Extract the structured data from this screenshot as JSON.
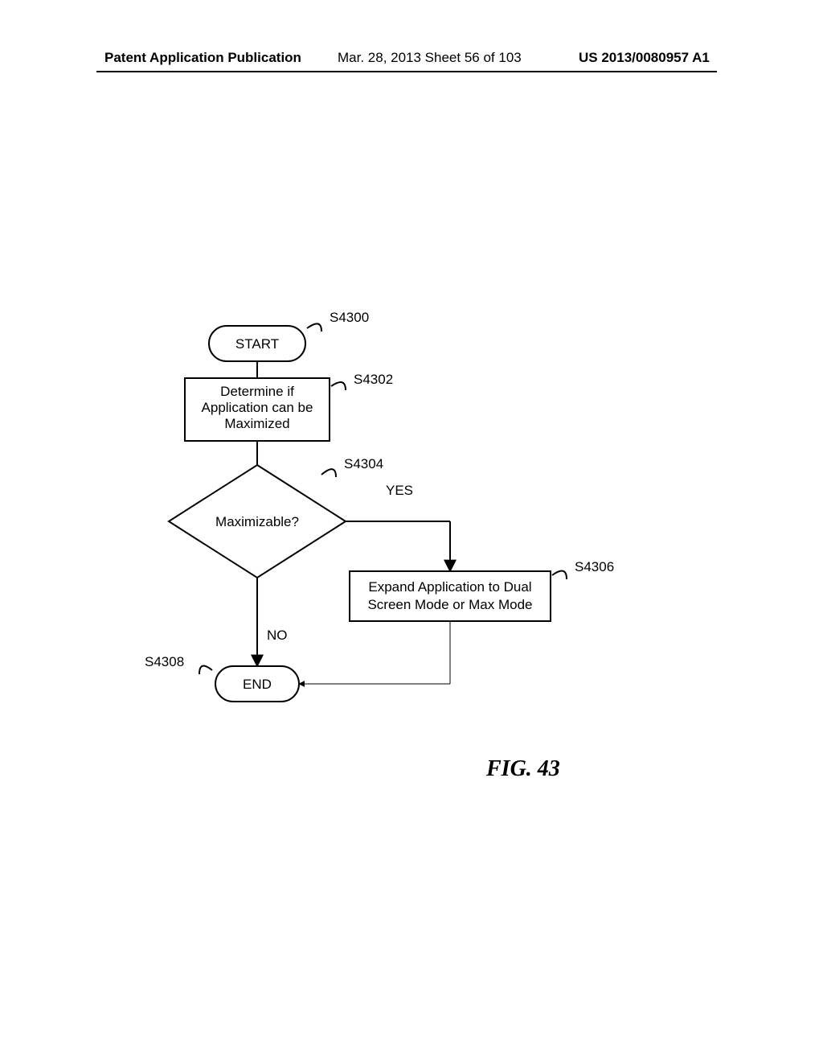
{
  "header": {
    "left": "Patent Application Publication",
    "mid": "Mar. 28, 2013  Sheet 56 of 103",
    "right": "US 2013/0080957 A1"
  },
  "flowchart": {
    "start": {
      "text": "START",
      "step": "S4300"
    },
    "determine": {
      "line1": "Determine if",
      "line2": "Application can be",
      "line3": "Maximized",
      "step": "S4302"
    },
    "decision": {
      "text": "Maximizable?",
      "step": "S4304",
      "yes": "YES",
      "no": "NO"
    },
    "expand": {
      "line1": "Expand Application to Dual",
      "line2": "Screen Mode or Max Mode",
      "step": "S4306"
    },
    "end": {
      "text": "END",
      "step": "S4308"
    }
  },
  "figure": {
    "caption": "FIG. 43"
  }
}
